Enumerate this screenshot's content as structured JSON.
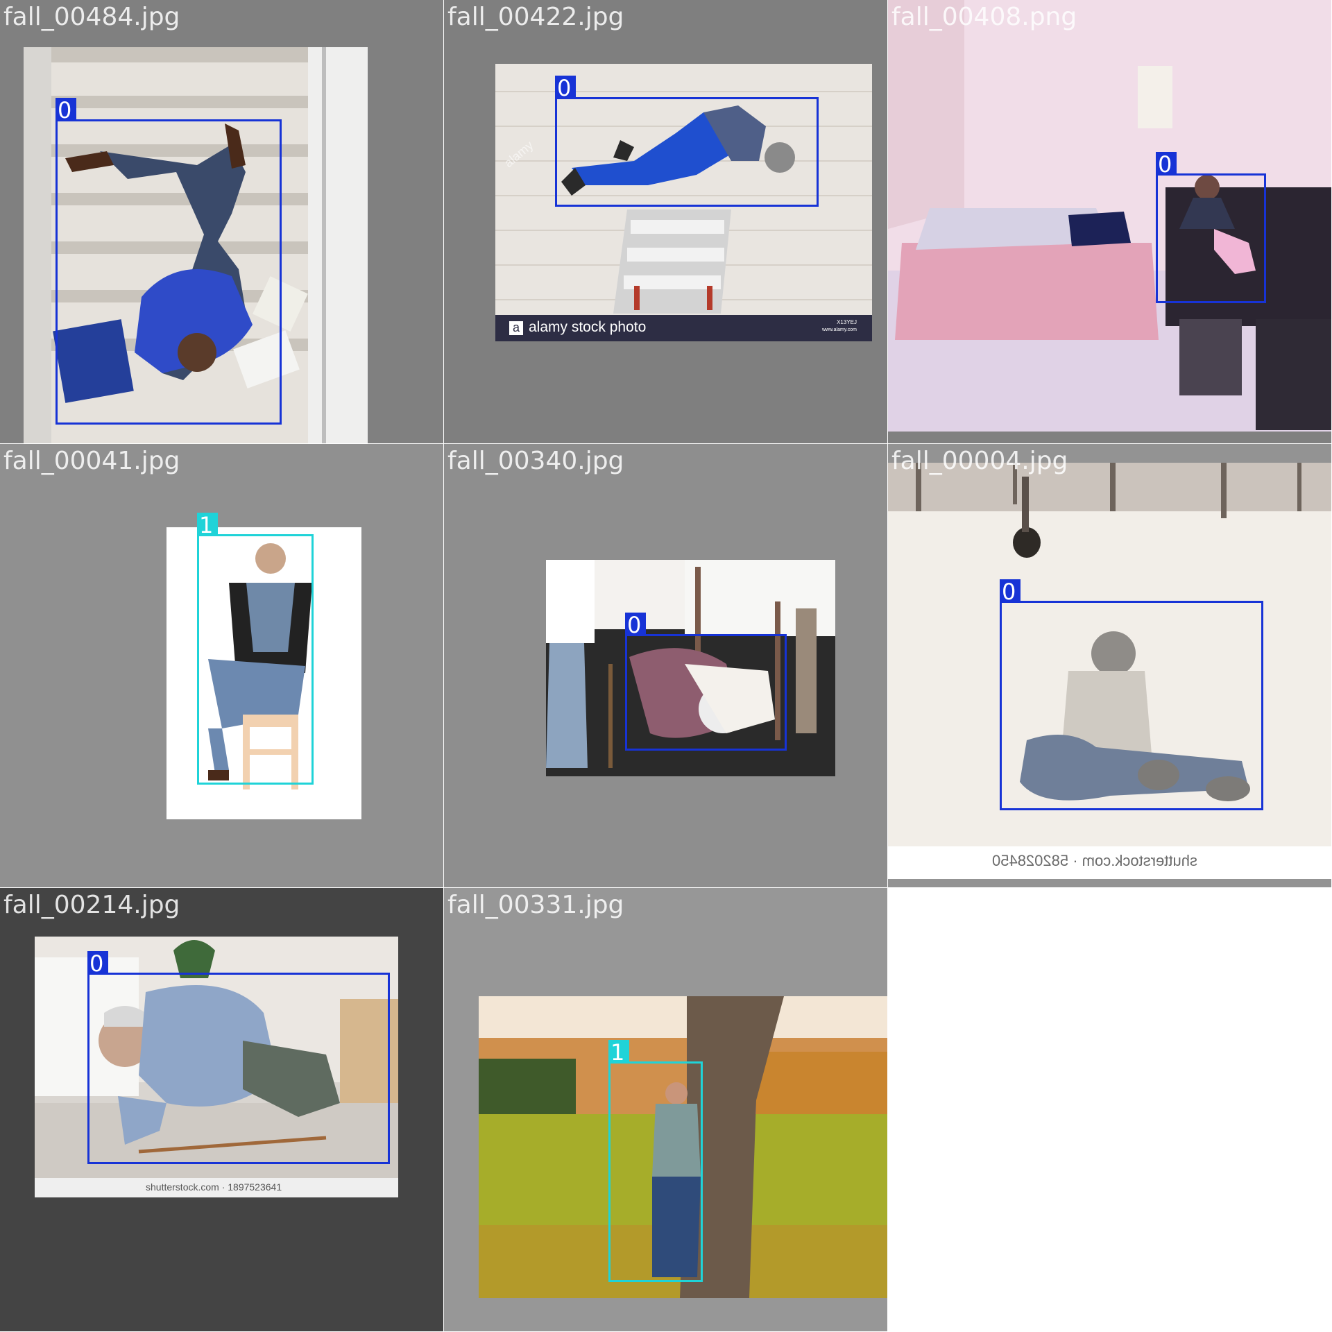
{
  "colors": {
    "class_0": "#1733d6",
    "class_1": "#1fd3d8",
    "label_text": "#ffffff"
  },
  "tiles": [
    {
      "filename": "fall_00484.jpg",
      "background": "#808080",
      "boxes": [
        {
          "class_label": "0"
        }
      ]
    },
    {
      "filename": "fall_00422.jpg",
      "background": "#7f7f7f",
      "boxes": [
        {
          "class_label": "0"
        }
      ],
      "watermark": {
        "logo_letter": "a",
        "text": "alamy stock photo",
        "code": "X13YEJ",
        "site": "www.alamy.com",
        "stamp": "alamy"
      }
    },
    {
      "filename": "fall_00408.png",
      "background": "#808080",
      "boxes": [
        {
          "class_label": "0"
        }
      ]
    },
    {
      "filename": "fall_00041.jpg",
      "background": "#909090",
      "boxes": [
        {
          "class_label": "1"
        }
      ]
    },
    {
      "filename": "fall_00340.jpg",
      "background": "#8e8e8e",
      "boxes": [
        {
          "class_label": "0"
        }
      ]
    },
    {
      "filename": "fall_00004.jpg",
      "background": "#939393",
      "boxes": [
        {
          "class_label": "0"
        }
      ],
      "watermark": {
        "text": "shutterstock.com · 582028450"
      }
    },
    {
      "filename": "fall_00214.jpg",
      "background": "#444444",
      "boxes": [
        {
          "class_label": "0"
        }
      ],
      "watermark": {
        "text": "shutterstock.com · 1897523641"
      }
    },
    {
      "filename": "fall_00331.jpg",
      "background": "#979797",
      "boxes": [
        {
          "class_label": "1"
        }
      ]
    }
  ]
}
